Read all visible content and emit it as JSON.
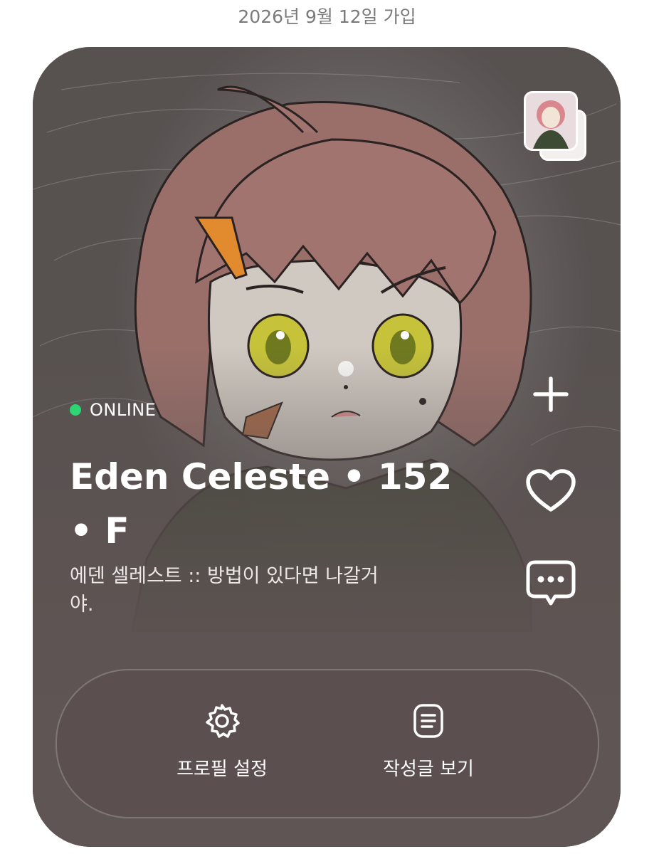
{
  "join_date": "2026년 9월 12일 가입",
  "profile": {
    "status": "ONLINE",
    "name": "Eden Celeste • 152 • F",
    "bio": "에덴 셀레스트 :: 방법이 있다면 나갈거야."
  },
  "colors": {
    "online": "#2ed573",
    "card": "#5f5554",
    "text": "#ffffff"
  },
  "side_actions": [
    {
      "icon": "plus-icon"
    },
    {
      "icon": "heart-icon"
    },
    {
      "icon": "chat-icon"
    }
  ],
  "bottom_actions": [
    {
      "icon": "gear-icon",
      "label": "프로필 설정"
    },
    {
      "icon": "document-icon",
      "label": "작성글 보기"
    }
  ]
}
